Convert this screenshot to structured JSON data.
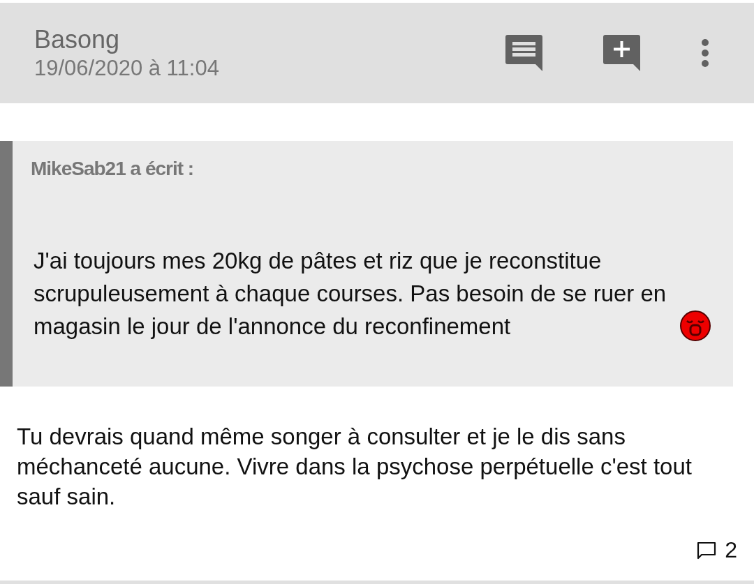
{
  "header": {
    "author": "Basong",
    "date": "19/06/2020 à 11:04"
  },
  "quote": {
    "author": "MikeSab21 a écrit :",
    "text": "J'ai toujours mes 20kg de pâtes et riz que je reconstitue scrupuleusement à chaque courses. Pas besoin de se ruer en magasin le jour de l'annonce du reconfinement"
  },
  "message": "Tu devrais quand même songer à consulter et je le dis sans méchanceté aucune. Vivre dans la psychose perpétuelle c'est tout sauf sain.",
  "footer": {
    "comment_count": "2"
  }
}
